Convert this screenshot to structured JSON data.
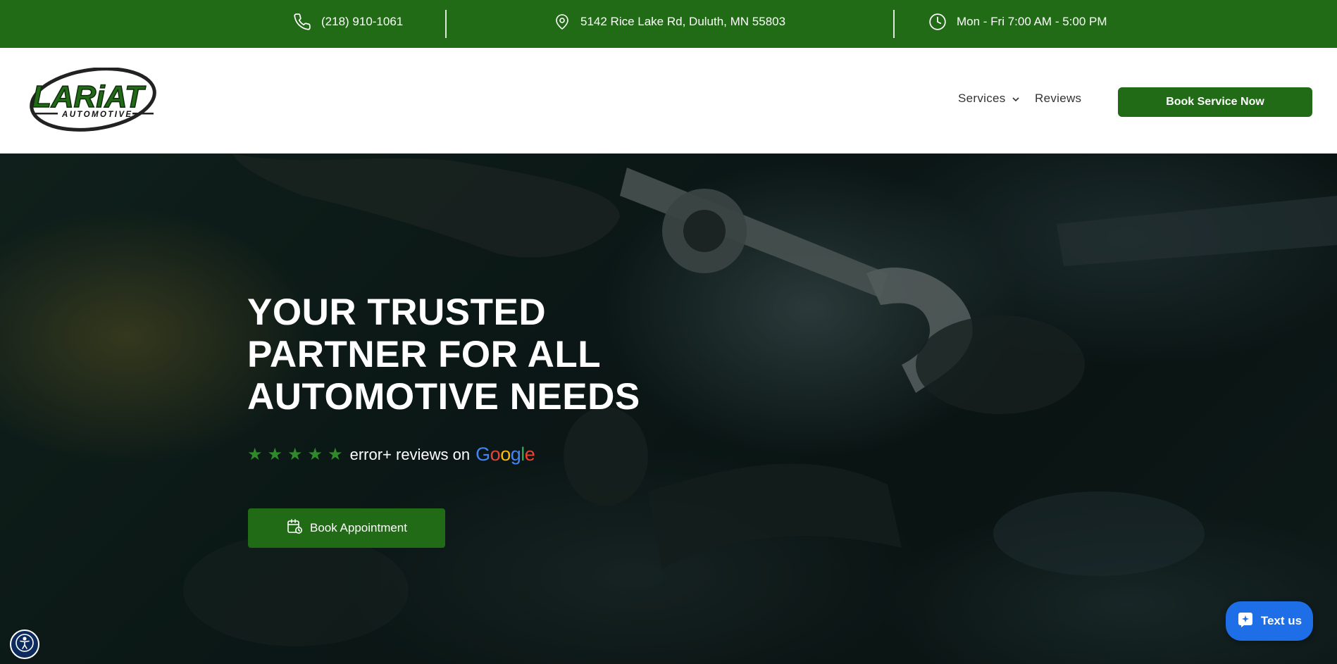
{
  "topbar": {
    "phone": "(218) 910-1061",
    "address": "5142 Rice Lake Rd, Duluth, MN 55803",
    "hours": "Mon - Fri 7:00 AM - 5:00 PM",
    "icons": [
      "phone-icon",
      "location-pin-icon",
      "clock-icon"
    ]
  },
  "header": {
    "logo_text": "LARiAT",
    "logo_subtext": "AUTOMOTIVE",
    "nav": {
      "services": "Services",
      "reviews": "Reviews"
    },
    "cta": "Book Service Now"
  },
  "hero": {
    "title_line1": "YOUR TRUSTED",
    "title_line2": "PARTNER FOR ALL",
    "title_line3": "AUTOMOTIVE NEEDS",
    "rating": {
      "stars": 5,
      "text": "error+ reviews on",
      "provider": "Google"
    },
    "cta": "Book Appointment"
  },
  "widgets": {
    "text_us": "Text us"
  },
  "colors": {
    "brand_green": "#216a16",
    "star_green": "#2f8a2a",
    "chat_blue": "#1e6ee8"
  }
}
